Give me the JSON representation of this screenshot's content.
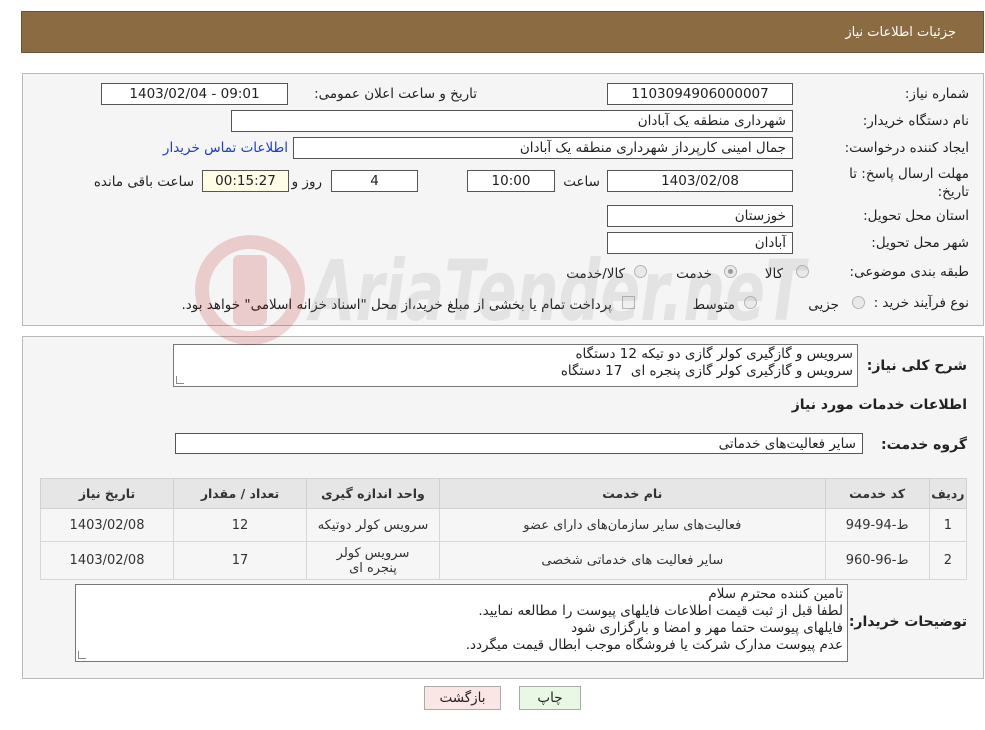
{
  "header": {
    "title": "جزئیات اطلاعات نیاز"
  },
  "form": {
    "need_number_label": "شماره نیاز:",
    "need_number": "1103094906000007",
    "announce_label": "تاریخ و ساعت اعلان عمومی:",
    "announce_value": "1403/02/04 - 09:01",
    "buyer_org_label": "نام دستگاه خریدار:",
    "buyer_org": "شهرداری منطقه یک آبادان",
    "creator_label": "ایجاد کننده درخواست:",
    "creator": "جمال امینی کارپرداز شهرداری منطقه یک آبادان",
    "contact_link": "اطلاعات تماس خریدار",
    "deadline_label_1": "مهلت ارسال پاسخ: تا",
    "deadline_label_2": "تاریخ:",
    "deadline_date": "1403/02/08",
    "time_label": "ساعت",
    "deadline_time": "10:00",
    "days": "4",
    "days_label": "روز و",
    "remaining": "00:15:27",
    "remaining_label": "ساعت باقی مانده",
    "province_label": "استان محل تحویل:",
    "province": "خوزستان",
    "city_label": "شهر محل تحویل:",
    "city": "آبادان",
    "category_label": "طبقه بندی موضوعی:",
    "category_options": [
      "کالا",
      "خدمت",
      "کالا/خدمت"
    ],
    "category_selected": "خدمت",
    "process_label": "نوع فرآیند خرید :",
    "process_options": [
      "جزیی",
      "متوسط"
    ],
    "payment_note": "پرداخت تمام یا بخشی از مبلغ خرید،از محل \"اسناد خزانه اسلامی\" خواهد بود."
  },
  "description": {
    "label": "شرح کلی نیاز:",
    "lines": [
      "سرویس و گازگیری کولر گازی دو تیکه 12 دستگاه",
      "سرویس و گازگیری کولر گازی پنجره ای  17 دستگاه"
    ]
  },
  "services": {
    "section_title": "اطلاعات خدمات مورد نیاز",
    "group_label": "گروه خدمت:",
    "group_value": "سایر فعالیت‌های خدماتی",
    "columns": [
      "ردیف",
      "کد خدمت",
      "نام خدمت",
      "واحد اندازه گیری",
      "تعداد / مقدار",
      "تاریخ نیاز"
    ],
    "rows": [
      [
        "1",
        "ط-94-949",
        "فعالیت‌های سایر سازمان‌های دارای عضو",
        "سرویس کولر دوتیکه",
        "12",
        "1403/02/08"
      ],
      [
        "2",
        "ط-96-960",
        "سایر فعالیت های خدماتی شخصی",
        "سرویس کولر پنجره ای",
        "17",
        "1403/02/08"
      ]
    ]
  },
  "buyer_notes": {
    "label": "توضیحات خریدار:",
    "lines": [
      "تامین کننده محترم سلام",
      "لطفا قبل از ثبت قیمت اطلاعات فایلهای پیوست را مطالعه نمایید.",
      "فایلهای پیوست حتما مهر و امضا و بارگزاری شود",
      "عدم پیوست مدارک شرکت یا فروشگاه موجب ابطال قیمت میگردد."
    ]
  },
  "buttons": {
    "print": "چاپ",
    "back": "بازگشت"
  },
  "watermark": "AriaTender.neT",
  "colors": {
    "header_bg": "#8b6b42",
    "print_bg": "#e9f8e4",
    "back_bg": "#fbe6e6",
    "link": "#1a3ec7"
  }
}
